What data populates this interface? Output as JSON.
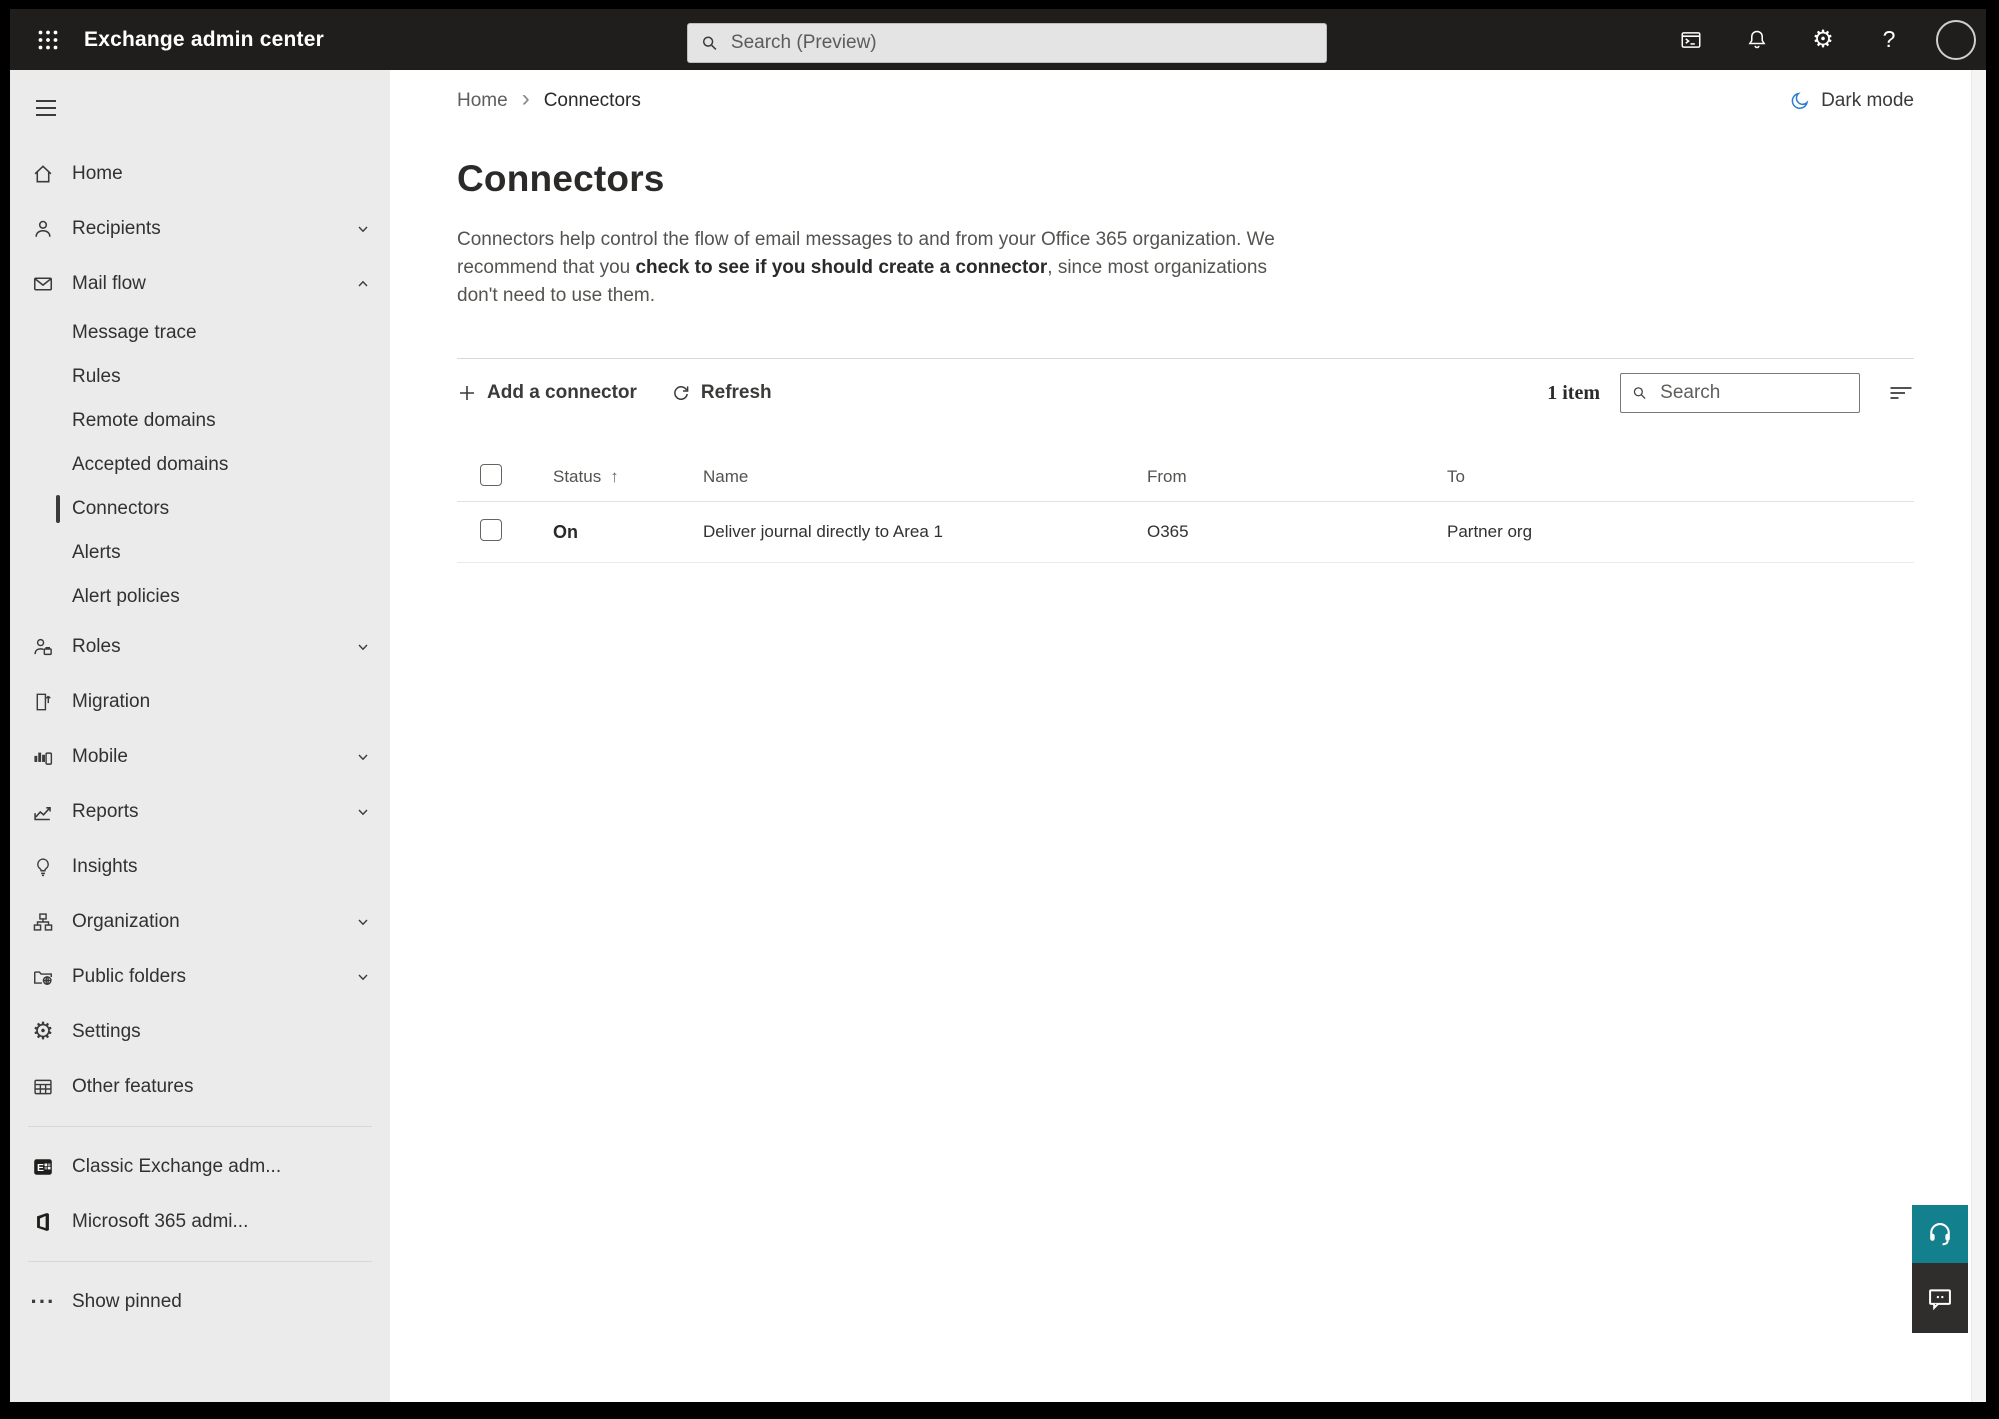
{
  "topbar": {
    "app_title": "Exchange admin center",
    "search_placeholder": "Search (Preview)",
    "help_glyph": "?",
    "gear_glyph": "⚙",
    "icons": [
      "app-launcher-icon",
      "search-icon",
      "terminal-icon",
      "bell-icon",
      "gear-icon",
      "help-icon",
      "avatar"
    ]
  },
  "sidebar": {
    "items": [
      {
        "label": "Home",
        "icon": "home-icon"
      },
      {
        "label": "Recipients",
        "icon": "person-icon",
        "chevron": "down"
      },
      {
        "label": "Mail flow",
        "icon": "envelope-icon",
        "chevron": "up"
      },
      {
        "label": "Message trace"
      },
      {
        "label": "Rules"
      },
      {
        "label": "Remote domains"
      },
      {
        "label": "Accepted domains"
      },
      {
        "label": "Connectors",
        "selected": true
      },
      {
        "label": "Alerts"
      },
      {
        "label": "Alert policies"
      },
      {
        "label": "Roles",
        "icon": "person-briefcase-icon",
        "chevron": "down"
      },
      {
        "label": "Migration",
        "icon": "document-arrow-icon"
      },
      {
        "label": "Mobile",
        "icon": "chart-phone-icon",
        "chevron": "down"
      },
      {
        "label": "Reports",
        "icon": "line-chart-icon",
        "chevron": "down"
      },
      {
        "label": "Insights",
        "icon": "lightbulb-icon"
      },
      {
        "label": "Organization",
        "icon": "org-chart-icon",
        "chevron": "down"
      },
      {
        "label": "Public folders",
        "icon": "folder-globe-icon",
        "chevron": "down"
      },
      {
        "label": "Settings",
        "icon": "gear-icon"
      },
      {
        "label": "Other features",
        "icon": "table-icon"
      },
      {
        "label": "Classic Exchange adm...",
        "icon": "exchange-logo-icon"
      },
      {
        "label": "Microsoft 365 admi...",
        "icon": "microsoft-365-logo-icon"
      },
      {
        "label": "Show pinned",
        "icon": "more-icon"
      }
    ],
    "more_glyph": "···",
    "gear_glyph": "⚙"
  },
  "page": {
    "breadcrumb": {
      "home": "Home",
      "separator": "›",
      "current": "Connectors"
    },
    "dark_mode_label": "Dark mode",
    "title": "Connectors",
    "description": {
      "pre": "Connectors help control the flow of email messages to and from your Office 365 organization. We recommend that you ",
      "bold": "check to see if you should create a connector",
      "post": ", since most organizations don't need to use them."
    },
    "toolbar": {
      "add_label": "Add a connector",
      "refresh_label": "Refresh",
      "count_label": "1 item",
      "search_placeholder": "Search"
    },
    "table": {
      "sort_arrow": "↑",
      "headers": {
        "status": "Status",
        "name": "Name",
        "from": "From",
        "to": "To"
      },
      "rows": [
        {
          "status": "On",
          "name": "Deliver journal directly to Area 1",
          "from": "O365",
          "to": "Partner org"
        }
      ]
    }
  },
  "colors": {
    "topbar_bg": "#1f1e1d",
    "sidebar_bg": "#ebebeb",
    "accent_teal": "#13808d",
    "feedback_dark": "#2f2e2d",
    "moon_blue": "#2b7cd3",
    "selected_marker": "#3b3a39"
  }
}
